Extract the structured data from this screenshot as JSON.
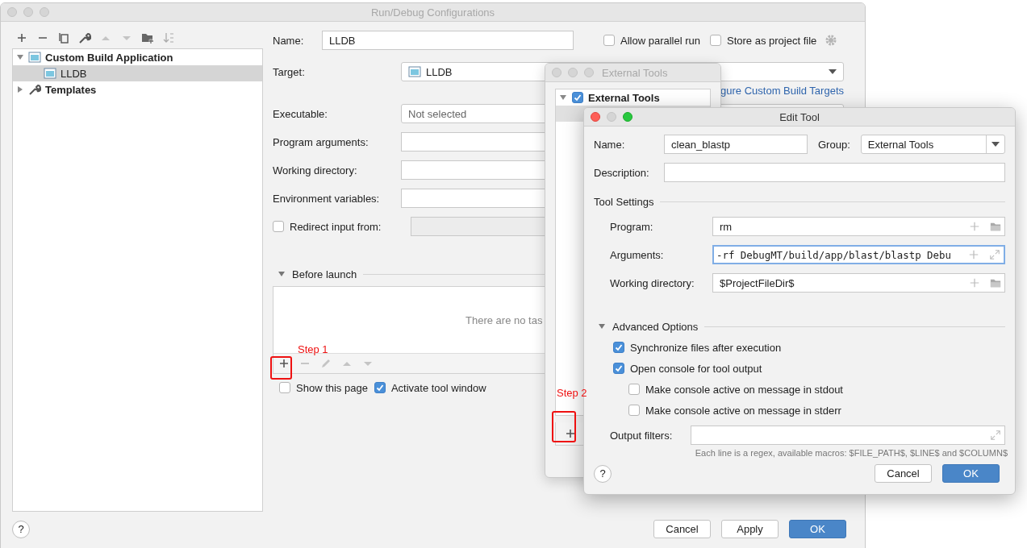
{
  "main_window": {
    "title": "Run/Debug Configurations",
    "tree": [
      {
        "label": "Custom Build Application",
        "expanded": true,
        "selected": false,
        "children": [
          {
            "label": "LLDB",
            "selected": true
          }
        ]
      },
      {
        "label": "Templates",
        "expanded": false,
        "selected": false
      }
    ],
    "name": {
      "label": "Name:",
      "value": "LLDB"
    },
    "allow_parallel": {
      "label": "Allow parallel run",
      "checked": false
    },
    "store_project": {
      "label": "Store as project file",
      "checked": false
    },
    "target": {
      "label": "Target:",
      "value": "LLDB"
    },
    "link": "gure Custom Build Targets",
    "executable": {
      "label": "Executable:",
      "value": "Not selected"
    },
    "fields": [
      {
        "label": "Program arguments:"
      },
      {
        "label": "Working directory:"
      },
      {
        "label": "Environment variables:"
      }
    ],
    "redirect": {
      "label": "Redirect input from:",
      "checked": false
    },
    "before_launch": {
      "title": "Before launch",
      "expanded": true,
      "empty_text": "There are no tas"
    },
    "options": [
      {
        "label": "Show this page",
        "checked": false
      },
      {
        "label": "Activate tool window",
        "checked": true
      }
    ],
    "help": "?",
    "buttons": [
      {
        "label": "Cancel",
        "default": false
      },
      {
        "label": "Apply",
        "default": false
      },
      {
        "label": "OK",
        "default": true
      }
    ]
  },
  "external_tools": {
    "title": "External Tools",
    "tree": [
      {
        "label": "External Tools",
        "checked": true,
        "expanded": true
      }
    ]
  },
  "edit_tool": {
    "title": "Edit Tool",
    "name": {
      "label": "Name:",
      "value": "clean_blastp"
    },
    "group": {
      "label": "Group:",
      "value": "External Tools"
    },
    "description": {
      "label": "Description:"
    },
    "tool_settings": {
      "title": "Tool Settings",
      "fields": [
        {
          "label": "Program:",
          "value": "rm",
          "focused": false,
          "kind": "browse"
        },
        {
          "label": "Arguments:",
          "value": "-rf DebugMT/build/app/blast/blastp Debu",
          "focused": true,
          "kind": "expand"
        },
        {
          "label": "Working directory:",
          "value": "$ProjectFileDir$",
          "focused": false,
          "kind": "browse"
        }
      ]
    },
    "advanced": {
      "title": "Advanced Options",
      "expanded": true,
      "options": [
        {
          "label": "Synchronize files after execution",
          "checked": true
        },
        {
          "label": "Open console for tool output",
          "checked": true,
          "children": [
            {
              "label": "Make console active on message in stdout",
              "checked": false
            },
            {
              "label": "Make console active on message in stderr",
              "checked": false
            }
          ]
        }
      ]
    },
    "output_filters": {
      "label": "Output filters:"
    },
    "help": "?",
    "hint": "Each line is a regex, available macros: $FILE_PATH$, $LINE$ and $COLUMN$",
    "buttons": [
      {
        "label": "Cancel",
        "default": false
      },
      {
        "label": "OK",
        "default": true
      }
    ]
  },
  "annotations": [
    {
      "label": "Step 1"
    },
    {
      "label": "Step 2"
    }
  ]
}
